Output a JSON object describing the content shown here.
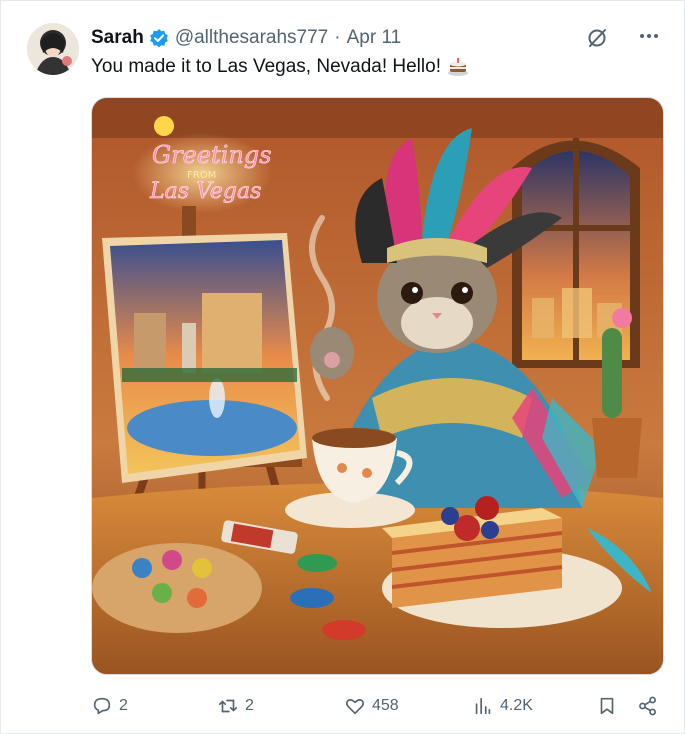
{
  "author": {
    "name": "Sarah",
    "handle": "@allthesarahs777",
    "separator": "·",
    "date": "Apr 11"
  },
  "tweet": {
    "text": "You made it to Las Vegas, Nevada! Hello!",
    "emoji_icon": "cake-icon"
  },
  "image": {
    "sign_line1": "Greetings",
    "sign_line2": "FROM",
    "sign_line3": "Las Vegas"
  },
  "actions": {
    "replies": "2",
    "reposts": "2",
    "likes": "458",
    "views": "4.2K"
  },
  "colors": {
    "text_primary": "#0f1419",
    "text_secondary": "#536471",
    "verified_blue": "#1d9bf0"
  }
}
